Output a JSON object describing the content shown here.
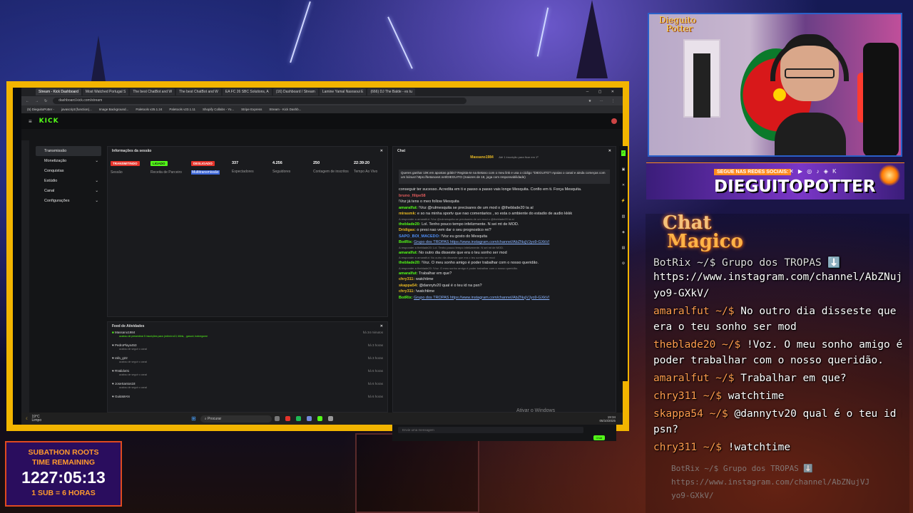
{
  "browser": {
    "tabs": [
      "Stream - Kick Dashboard",
      "Most Watched Portugal S",
      "The best ChatBot and W",
      "The best ChatBot and W",
      "EA FC 26 SBC Solutions, A",
      "(16) Dashboard / Stream",
      "Lamine Yamal Nasraoui E",
      "(666) DJ The Balde - es tu"
    ],
    "url": "dashboard.kick.com/stream",
    "bookmarks": [
      "(5) DieguitoPotter -",
      "javascript:(function(...",
      "Image Background...",
      "Paletools v25.1.24",
      "Paletools v23.1.11",
      "Shopify Collabs - Yo...",
      "Stripe Express",
      "Stream - Kick Dashb..."
    ]
  },
  "kick": {
    "logo": "KICK",
    "menu": [
      {
        "label": "Transmissão",
        "arrow": ""
      },
      {
        "label": "Monetização",
        "arrow": "⌄"
      },
      {
        "label": "Conquistas",
        "arrow": ""
      },
      {
        "label": "Estúdio",
        "arrow": "⌄"
      },
      {
        "label": "Canal",
        "arrow": "⌄"
      },
      {
        "label": "Configurações",
        "arrow": "⌄"
      }
    ],
    "session": {
      "title": "Informações da sessão",
      "stats": [
        {
          "value": "TRANSMITINDO",
          "label": "Sessão",
          "badge": "#e5332a"
        },
        {
          "value": "LIGADO",
          "label": "Receita de Parceiro",
          "badge": "#53fc18"
        },
        {
          "value": "DESLIGADO",
          "label": "Multitransmissão",
          "badge": "#e5332a"
        },
        {
          "value": "337",
          "label": "Espectadores",
          "badge": ""
        },
        {
          "value": "4.256",
          "label": "Seguidores",
          "badge": ""
        },
        {
          "value": "250",
          "label": "Contagem de inscritos",
          "badge": ""
        },
        {
          "value": "22:39:20",
          "label": "Tempo Ao Vivo",
          "badge": ""
        }
      ]
    },
    "feed": {
      "title": "Feed de Atividades",
      "rows": [
        {
          "name": "Massano1984",
          "sub": "acabou de presentear 5 inscrições para: jediml:ro13, tilliris, , gascot, bobregome",
          "time": "há 34 minutos"
        },
        {
          "name": "PedroPlays453",
          "sub": "acabou de seguir o canal",
          "time": "há 3 horas"
        },
        {
          "name": "rafa_g22",
          "sub": "acabou de seguir o canal",
          "time": "há 3 horas"
        },
        {
          "name": "RValido01",
          "sub": "acabou de seguir o canal",
          "time": "há 6 horas"
        },
        {
          "name": "JoseSantos18",
          "sub": "acabou de seguir o canal",
          "time": "há 6 horas"
        },
        {
          "name": "GuitaMAN",
          "sub": "acabou de seguir o canal",
          "time": "há 6 horas"
        }
      ]
    },
    "chat": {
      "title": "Chat",
      "pinned_user": "Massano1984",
      "pinned_note": "Até 1 inscrição para ficar em 1º",
      "promo": "Queres ganhar 10€ em apostas grátis? Regista-te na Betano com o meu link e usa o código \"DIEGUITO\"! Apoias o canal e ainda começas com um bónus! https://betanoext.net/DIEGUITO (maiores de 18, joga com responsabilidade)",
      "messages": [
        {
          "user": "",
          "text": "conseguir ter sucesso. Acredita em ti e passo a passo vais longe Mesquita. Confio em ti. Força Mesquita.",
          "color": "u-green",
          "reply": ""
        },
        {
          "user": "bruno_filipe58",
          "text": "",
          "color": "u-red",
          "reply": ""
        },
        {
          "user": "",
          "text": "!Voz já tens o meo follow Mesquita",
          "color": "u-green",
          "reply": ""
        },
        {
          "user": "amaralfut:",
          "text": "!Voz @rulmesquita se precisares de um mod o @theblade20 ta aí",
          "color": "u-green",
          "reply": ""
        },
        {
          "user": "mirasmk:",
          "text": "e so na minha sportv que nao comentarios , so esta o ambiente do estadio de audio kkkk",
          "color": "u-gold",
          "reply": ""
        },
        {
          "user": "theblade20:",
          "text": "Lol. Tenho pouco tempo infelizmente. N sei mt de MOD.",
          "color": "u-green",
          "reply": "A responder a amaralfut: !Voz @rulmesquita se precisares de um mod o @theblade20 ta aí"
        },
        {
          "user": "Dridigas:",
          "text": "o presi nao vem dar o seu prognostico rei?",
          "color": "u-gold",
          "reply": ""
        },
        {
          "user": "SAPO_BOI_MACEDO:",
          "text": "!Voz eu gosto do Mesquita",
          "color": "u-blue",
          "reply": ""
        },
        {
          "user": "BotRix:",
          "text": "Grupo dos TROPAS https://www.instagram.com/channel/AbZNujVJyo9-GXkV/",
          "color": "u-green",
          "reply": ""
        },
        {
          "user": "amaralfut:",
          "text": "No outro dia disseste que era o teu sonho ser mod",
          "color": "u-green",
          "reply": "A responder a theblade20: Lol. Tenho pouco tempo infelizmente. N sei mt de MOD."
        },
        {
          "user": "theblade20:",
          "text": "!Voz. O meu sonho amigo é poder trabalhar com o nosso queridão.",
          "color": "u-green",
          "reply": "A responder a amaralfut: No outro dia disseste que era o teu sonho ser mod"
        },
        {
          "user": "amaralfut:",
          "text": "Trabalhar em que?",
          "color": "u-green",
          "reply": "A responder a theblade20: !Voz. O meu sonho amigo é poder trabalhar com o nosso queridão."
        },
        {
          "user": "chry311:",
          "text": "watchtime",
          "color": "u-gold",
          "reply": ""
        },
        {
          "user": "skappa54:",
          "text": "@dannytv20 qual é o teu id na psn?",
          "color": "u-gold",
          "reply": ""
        },
        {
          "user": "chry311:",
          "text": "!watchtime",
          "color": "u-gold",
          "reply": ""
        },
        {
          "user": "BotRix:",
          "text": "Grupo dos TROPAS https://www.instagram.com/channel/AbZNujVJyo9-GXkV/",
          "color": "u-green",
          "reply": ""
        }
      ],
      "followers_only": "Apenas seguidores",
      "input_placeholder": "Envie uma mensagem",
      "send": "Chat",
      "windows_watermark_1": "Ativar o Windows",
      "windows_watermark_2": "Aceda a Definições para ativar o Windows."
    }
  },
  "taskbar": {
    "weather_temp": "19°C",
    "weather_text": "Limpo",
    "search": "Procurar",
    "time": "19:34",
    "date": "05/10/2025"
  },
  "banner": {
    "follow_text": "SEGUE NAS REDES SOCIAIS:",
    "handle": "DIEGUITOPOTTER"
  },
  "cam_logo": [
    "Dieguito",
    "Potter"
  ],
  "overlay_chat": {
    "logo_line1": "Chat",
    "logo_line2": "Magico",
    "lines": [
      {
        "name": "",
        "text": "BotRix ~/$ Grupo dos TROPAS ⬇️"
      },
      {
        "name": "",
        "text": "https://www.instagram.com/channel/AbZNujVJ"
      },
      {
        "name": "",
        "text": "yo9-GXkV/"
      },
      {
        "name": "amaralfut ~/$",
        "text": " No outro dia disseste que"
      },
      {
        "name": "",
        "text": "era o teu sonho ser mod"
      },
      {
        "name": "theblade20 ~/$",
        "text": " !Voz. O meu sonho amigo é"
      },
      {
        "name": "",
        "text": "poder trabalhar com o nosso queridão."
      },
      {
        "name": "amaralfut ~/$",
        "text": " Trabalhar em que?"
      },
      {
        "name": "chry311 ~/$",
        "text": " watchtime"
      },
      {
        "name": "skappa54 ~/$",
        "text": " @dannytv20 qual é o teu id na"
      },
      {
        "name": "",
        "text": "psn?"
      },
      {
        "name": "chry311 ~/$",
        "text": " !watchtime"
      }
    ],
    "faded": [
      "BotRix ~/$ Grupo dos TROPAS ⬇️",
      "https://www.instagram.com/channel/AbZNujVJ",
      "yo9-GXkV/"
    ]
  },
  "subathon": {
    "line1": "SUBATHON ROOTS",
    "line2": "TIME REMAINING",
    "timer": "1227:05:13",
    "rate": "1 SUB = 6 HORAS"
  },
  "colors": {
    "frame": "#f2b400",
    "kick_green": "#53fc18",
    "subathon_border": "#e04a20"
  }
}
